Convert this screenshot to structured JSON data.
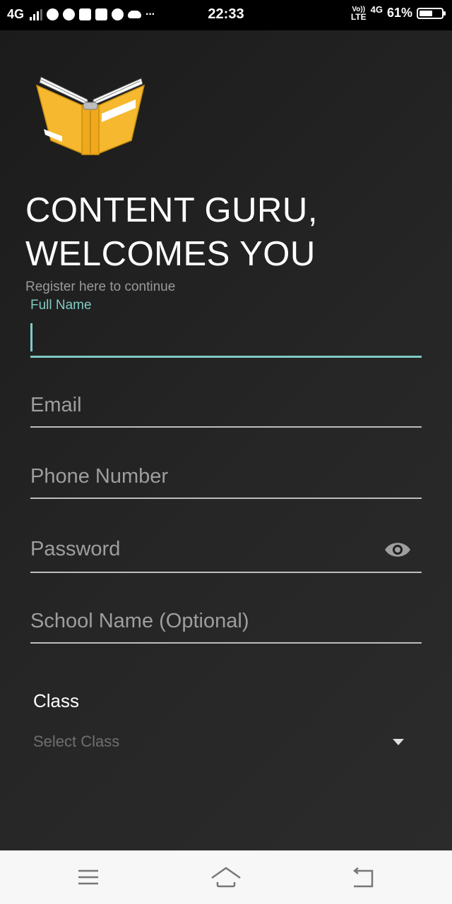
{
  "status_bar": {
    "network": "4G",
    "time": "22:33",
    "volte_top": "Vo))",
    "volte_bottom": "LTE",
    "network2": "4G",
    "battery": "61%",
    "notification_icons": [
      "message-icon",
      "check-icon",
      "youtube-icon",
      "email-icon",
      "chrome-icon",
      "cloud-icon"
    ],
    "more": "···"
  },
  "app": {
    "title_line1": "CONTENT GURU,",
    "title_line2": "WELCOMES YOU",
    "subtitle": "Register here to continue"
  },
  "form": {
    "full_name": {
      "label": "Full Name",
      "value": ""
    },
    "email": {
      "placeholder": "Email",
      "value": ""
    },
    "phone": {
      "placeholder": "Phone Number",
      "value": ""
    },
    "password": {
      "placeholder": "Password",
      "value": ""
    },
    "school": {
      "placeholder": "School Name (Optional)",
      "value": ""
    },
    "class_label": "Class",
    "class_select": {
      "value": "Select Class"
    }
  },
  "colors": {
    "accent": "#80cbc4",
    "background": "#242424",
    "logo_yellow": "#f5b82e"
  }
}
